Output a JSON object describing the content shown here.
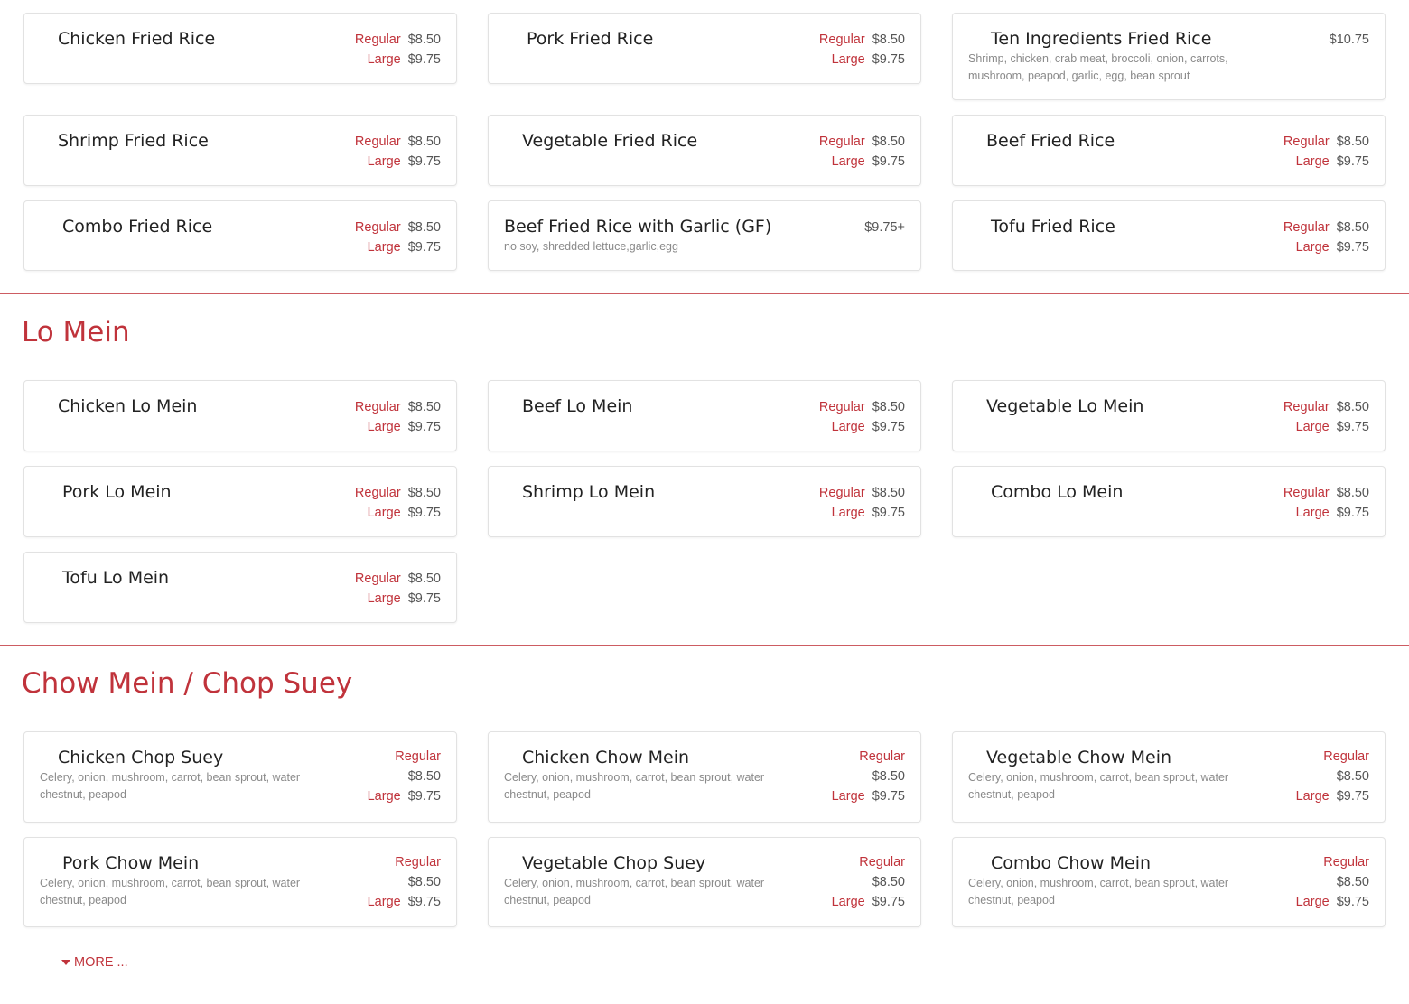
{
  "fried_rice": [
    {
      "name": "Chicken Fried Rice",
      "regular_label": "Regular",
      "regular": "$8.50",
      "large_label": "Large",
      "large": "$9.75"
    },
    {
      "name": "Pork Fried Rice",
      "regular_label": "Regular",
      "regular": "$8.50",
      "large_label": "Large",
      "large": "$9.75"
    },
    {
      "name": "Ten Ingredients Fried Rice",
      "price": "$10.75",
      "desc": "Shrimp, chicken, crab meat, broccoli, onion, carrots, mushroom, peapod, garlic, egg, bean sprout"
    },
    {
      "name": "Shrimp Fried Rice",
      "regular_label": "Regular",
      "regular": "$8.50",
      "large_label": "Large",
      "large": "$9.75"
    },
    {
      "name": "Vegetable Fried Rice",
      "regular_label": "Regular",
      "regular": "$8.50",
      "large_label": "Large",
      "large": "$9.75"
    },
    {
      "name": "Beef Fried Rice",
      "regular_label": "Regular",
      "regular": "$8.50",
      "large_label": "Large",
      "large": "$9.75"
    },
    {
      "name": "Combo Fried Rice",
      "regular_label": "Regular",
      "regular": "$8.50",
      "large_label": "Large",
      "large": "$9.75"
    },
    {
      "name": "Beef Fried Rice with Garlic (GF)",
      "price": "$9.75+",
      "desc": "no soy, shredded lettuce,garlic,egg"
    },
    {
      "name": "Tofu Fried Rice",
      "regular_label": "Regular",
      "regular": "$8.50",
      "large_label": "Large",
      "large": "$9.75"
    }
  ],
  "lo_mein": {
    "title": "Lo Mein",
    "items": [
      {
        "name": "Chicken Lo Mein",
        "regular_label": "Regular",
        "regular": "$8.50",
        "large_label": "Large",
        "large": "$9.75"
      },
      {
        "name": "Beef Lo Mein",
        "regular_label": "Regular",
        "regular": "$8.50",
        "large_label": "Large",
        "large": "$9.75"
      },
      {
        "name": "Vegetable Lo Mein",
        "regular_label": "Regular",
        "regular": "$8.50",
        "large_label": "Large",
        "large": "$9.75"
      },
      {
        "name": "Pork Lo Mein",
        "regular_label": "Regular",
        "regular": "$8.50",
        "large_label": "Large",
        "large": "$9.75"
      },
      {
        "name": "Shrimp Lo Mein",
        "regular_label": "Regular",
        "regular": "$8.50",
        "large_label": "Large",
        "large": "$9.75"
      },
      {
        "name": "Combo Lo Mein",
        "regular_label": "Regular",
        "regular": "$8.50",
        "large_label": "Large",
        "large": "$9.75"
      },
      {
        "name": "Tofu Lo Mein",
        "regular_label": "Regular",
        "regular": "$8.50",
        "large_label": "Large",
        "large": "$9.75"
      }
    ]
  },
  "chow_mein": {
    "title": "Chow Mein / Chop Suey",
    "items": [
      {
        "name": "Chicken Chop Suey",
        "desc": "Celery, onion, mushroom, carrot, bean sprout, water chestnut, peapod",
        "regular_label": "Regular",
        "regular": "$8.50",
        "large_label": "Large",
        "large": "$9.75"
      },
      {
        "name": "Chicken Chow Mein",
        "desc": "Celery, onion, mushroom, carrot, bean sprout, water chestnut, peapod",
        "regular_label": "Regular",
        "regular": "$8.50",
        "large_label": "Large",
        "large": "$9.75"
      },
      {
        "name": "Vegetable Chow Mein",
        "desc": "Celery, onion, mushroom, carrot, bean sprout, water chestnut, peapod",
        "regular_label": "Regular",
        "regular": "$8.50",
        "large_label": "Large",
        "large": "$9.75"
      },
      {
        "name": "Pork Chow Mein",
        "desc": "Celery, onion, mushroom, carrot, bean sprout, water chestnut, peapod",
        "regular_label": "Regular",
        "regular": "$8.50",
        "large_label": "Large",
        "large": "$9.75"
      },
      {
        "name": "Vegetable Chop Suey",
        "desc": "Celery, onion, mushroom, carrot, bean sprout, water chestnut, peapod",
        "regular_label": "Regular",
        "regular": "$8.50",
        "large_label": "Large",
        "large": "$9.75"
      },
      {
        "name": "Combo Chow Mein",
        "desc": "Celery, onion, mushroom, carrot, bean sprout, water chestnut, peapod",
        "regular_label": "Regular",
        "regular": "$8.50",
        "large_label": "Large",
        "large": "$9.75"
      }
    ]
  },
  "more_label": "MORE ...",
  "colors": {
    "accent": "#c0333b",
    "text": "#222222",
    "muted": "#8a8a8a",
    "border": "#e2e2e2"
  }
}
